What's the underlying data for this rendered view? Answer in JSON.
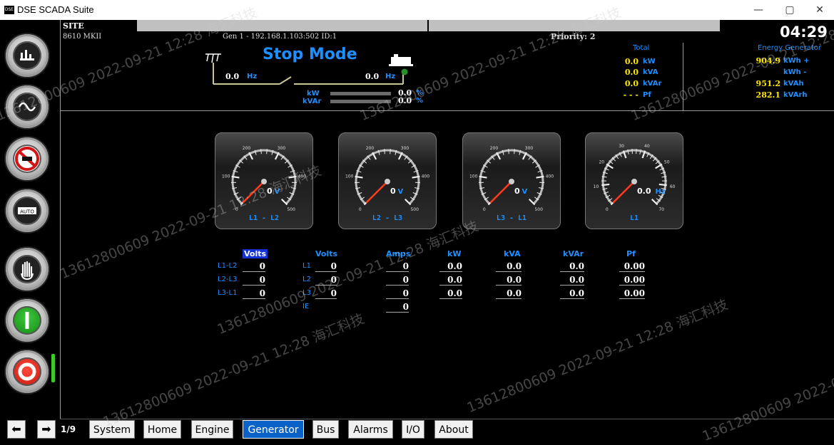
{
  "window": {
    "title": "DSE SCADA Suite",
    "app_icon": "DSE",
    "controls": [
      "—",
      "▢",
      "✕"
    ]
  },
  "header": {
    "site": "SITE",
    "model": "8610 MKII",
    "connection": "Gen 1 - 192.168.1.103:502 ID:1",
    "priority": "Priority: 2",
    "time": "04:29"
  },
  "mode": {
    "label": "Stop Mode",
    "bus_freq": "0.0",
    "bus_freq_unit": "Hz",
    "gen_freq": "0.0",
    "gen_freq_unit": "Hz",
    "kw_label": "kW",
    "kw_pct": "0.0",
    "kw_unit": "%",
    "kvar_label": "kVAr",
    "kvar_pct": "0.0",
    "kvar_unit": "%",
    "kw_level": 0,
    "kvar_level": 0
  },
  "totals": {
    "title": "Total",
    "rows": [
      {
        "value": "0.0",
        "unit": "kW"
      },
      {
        "value": "0.0",
        "unit": "kVA"
      },
      {
        "value": "0.0",
        "unit": "kVAr"
      },
      {
        "value": "- - -",
        "unit": "Pf"
      }
    ]
  },
  "energy": {
    "title": "Energy Generator",
    "rows": [
      {
        "value": "904.9",
        "unit": "kWh +"
      },
      {
        "value": "",
        "unit": "kWh -"
      },
      {
        "value": "951.2",
        "unit": "kVAh"
      },
      {
        "value": "282.1",
        "unit": "kVArh"
      }
    ]
  },
  "gauges": [
    {
      "label": "L1 - L2",
      "value": "0",
      "unit": "V",
      "ticks": [
        "0",
        "100",
        "200",
        "300",
        "400",
        "500"
      ]
    },
    {
      "label": "L2 - L3",
      "value": "0",
      "unit": "V",
      "ticks": [
        "0",
        "100",
        "200",
        "300",
        "400",
        "500"
      ]
    },
    {
      "label": "L3 - L1",
      "value": "0",
      "unit": "V",
      "ticks": [
        "0",
        "100",
        "200",
        "300",
        "400",
        "500"
      ]
    },
    {
      "label": "L1",
      "value": "0.0",
      "unit": "Hz",
      "ticks": [
        "0",
        "10",
        "20",
        "30",
        "40",
        "50",
        "60",
        "70"
      ]
    }
  ],
  "table": {
    "headers": {
      "volts_ll": "Volts",
      "volts_ln": "Volts",
      "amps": "Amps",
      "kw": "kW",
      "kva": "kVA",
      "kvar": "kVAr",
      "pf": "Pf"
    },
    "ll_labels": [
      "L1-L2",
      "L2-L3",
      "L3-L1"
    ],
    "ll_values": [
      "0",
      "0",
      "0"
    ],
    "ln_labels": [
      "L1",
      "L2",
      "L3",
      "IE"
    ],
    "ln_values": [
      "0",
      "0",
      "0"
    ],
    "amps": [
      "0",
      "0",
      "0",
      "0"
    ],
    "kw": [
      "0.0",
      "0.0",
      "0.0"
    ],
    "kva": [
      "0.0",
      "0.0",
      "0.0"
    ],
    "kvar": [
      "0.0",
      "0.0",
      "0.0"
    ],
    "pf": [
      "0.00",
      "0.00",
      "0.00"
    ]
  },
  "nav": {
    "page": "1/9",
    "buttons": [
      "System",
      "Home",
      "Engine",
      "Generator",
      "Bus",
      "Alarms",
      "I/O",
      "About"
    ],
    "active": "Generator"
  },
  "watermark": {
    "phone": "13612800609",
    "datetime": "2022-09-21 12:28",
    "company": "海汇科技"
  },
  "colors": {
    "accent": "#1e8fff",
    "energy_values": "#ffe800",
    "active_tab": "#0a62c8",
    "needle": "#ff3b1a"
  }
}
